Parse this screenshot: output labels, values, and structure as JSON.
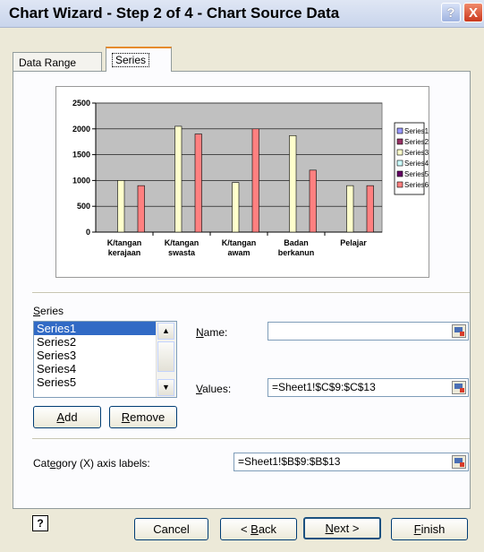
{
  "window": {
    "title": "Chart Wizard - Step 2 of 4 - Chart Source Data",
    "help_glyph": "?",
    "close_glyph": "X"
  },
  "tabs": [
    "Data Range",
    "Series"
  ],
  "chart_data": {
    "type": "bar",
    "categories": [
      [
        "K/tangan",
        "kerajaan"
      ],
      [
        "K/tangan",
        "swasta"
      ],
      [
        "K/tangan",
        "awam"
      ],
      [
        "Badan",
        "berkanun"
      ],
      [
        "Pelajar"
      ]
    ],
    "series": [
      {
        "name": "Series1",
        "values": [
          0,
          0,
          0,
          0,
          0
        ],
        "color": "#9999ff"
      },
      {
        "name": "Series2",
        "values": [
          0,
          0,
          0,
          0,
          0
        ],
        "color": "#993366"
      },
      {
        "name": "Series3",
        "values": [
          1000,
          2050,
          960,
          1870,
          900
        ],
        "color": "#ffffcc"
      },
      {
        "name": "Series4",
        "values": [
          0,
          0,
          0,
          0,
          0
        ],
        "color": "#ccffff"
      },
      {
        "name": "Series5",
        "values": [
          0,
          0,
          0,
          0,
          0
        ],
        "color": "#660066"
      },
      {
        "name": "Series6",
        "values": [
          900,
          1900,
          2000,
          1200,
          900
        ],
        "color": "#ff8080"
      }
    ],
    "yticks": [
      "0",
      "500",
      "1000",
      "1500",
      "2000",
      "2500"
    ],
    "ylim": [
      0,
      2500
    ],
    "plot_bg": "#c0c0c0",
    "grid": true,
    "legend": "right"
  },
  "series_section": {
    "label_prefix": "",
    "label_u": "S",
    "label_rest": "eries",
    "items": [
      "Series1",
      "Series2",
      "Series3",
      "Series4",
      "Series5"
    ],
    "selected_index": 0,
    "add_u": "A",
    "add_rest": "dd",
    "remove_u": "R",
    "remove_rest": "emove"
  },
  "name_field": {
    "label_u": "N",
    "label_rest": "ame:",
    "value": ""
  },
  "values_field": {
    "label_u": "V",
    "label_rest": "alues:",
    "value": "=Sheet1!$C$9:$C$13"
  },
  "category_field": {
    "label_pre": "Cat",
    "label_u": "e",
    "label_rest": "gory (X) axis labels:",
    "value": "=Sheet1!$B$9:$B$13"
  },
  "buttons": {
    "help_glyph": "?",
    "cancel": "Cancel",
    "back_pre": "< ",
    "back_u": "B",
    "back_rest": "ack",
    "next_u": "N",
    "next_rest": "ext >",
    "finish_u": "F",
    "finish_rest": "inish"
  }
}
